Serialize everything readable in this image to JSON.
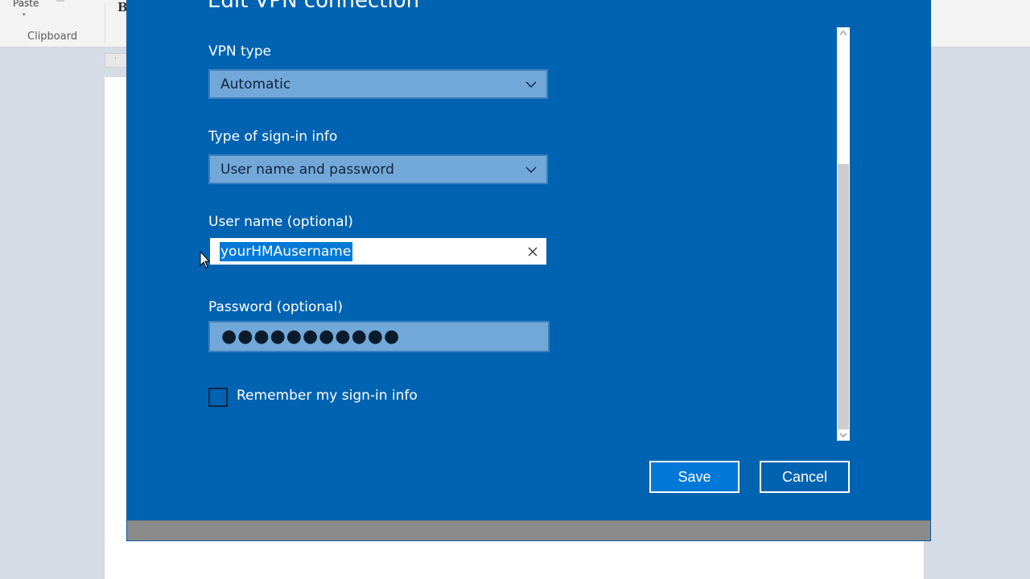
{
  "background_app": {
    "ribbon_paste": "Paste",
    "ribbon_clipboard": "Clipboard",
    "ribbon_bold": "B"
  },
  "dialog": {
    "title": "Edit VPN connection",
    "vpn_type": {
      "label": "VPN type",
      "value": "Automatic"
    },
    "signin_type": {
      "label": "Type of sign-in info",
      "value": "User name and password"
    },
    "username": {
      "label": "User name (optional)",
      "value": "yourHMAusername"
    },
    "password": {
      "label": "Password (optional)",
      "masked_value": "●●●●●●●●●●●"
    },
    "remember": {
      "label": "Remember my sign-in info",
      "checked": false
    },
    "buttons": {
      "save": "Save",
      "cancel": "Cancel"
    }
  },
  "colors": {
    "dialog_background": "#0063b1",
    "field_background": "#72a8d8",
    "selection_highlight": "#0078d7"
  },
  "icons": [
    "chevron-down-icon",
    "clear-icon",
    "scroll-up-icon",
    "scroll-down-icon",
    "mouse-pointer-icon"
  ]
}
